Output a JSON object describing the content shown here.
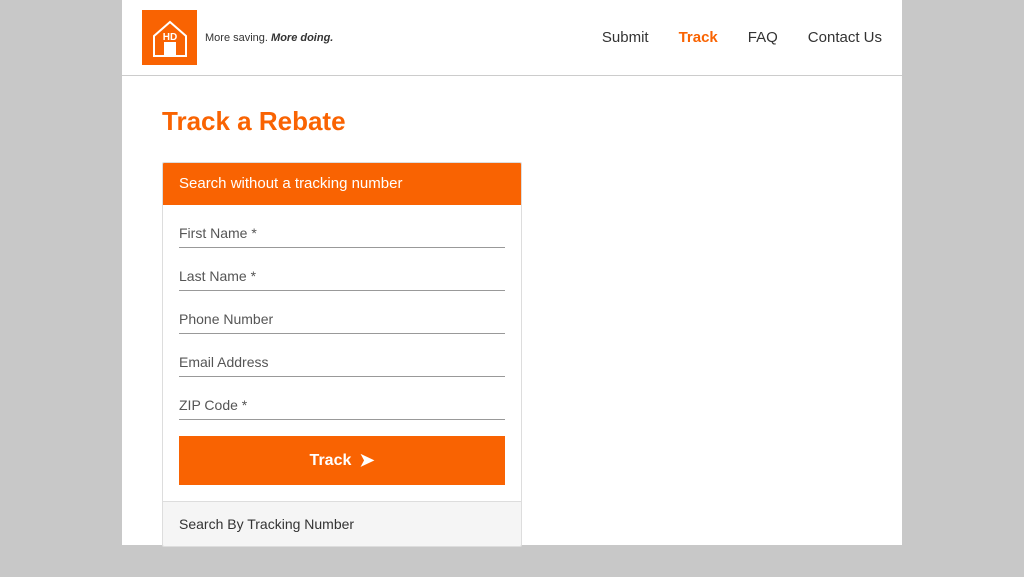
{
  "header": {
    "logo_tagline": "More saving. More doing.",
    "nav": {
      "submit": "Submit",
      "track": "Track",
      "faq": "FAQ",
      "contact_us": "Contact Us"
    }
  },
  "main": {
    "page_title": "Track a Rebate",
    "form_card": {
      "header_text": "Search without a tracking number",
      "fields": [
        {
          "placeholder": "First Name *"
        },
        {
          "placeholder": "Last Name *"
        },
        {
          "placeholder": "Phone Number"
        },
        {
          "placeholder": "Email Address"
        },
        {
          "placeholder": "ZIP Code *"
        }
      ],
      "track_button_label": "Track",
      "search_tracking_label": "Search By Tracking Number"
    }
  }
}
